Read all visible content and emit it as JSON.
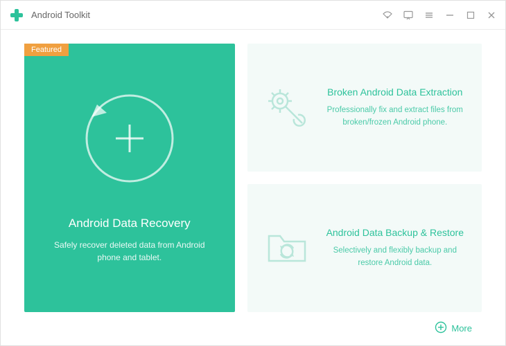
{
  "app": {
    "title": "Android Toolkit"
  },
  "featured_badge": "Featured",
  "cards": {
    "recovery": {
      "title": "Android Data Recovery",
      "desc": "Safely recover deleted data from Android phone and tablet."
    },
    "extraction": {
      "title": "Broken Android Data Extraction",
      "desc": "Professionally fix and extract files from broken/frozen Android phone."
    },
    "backup": {
      "title": "Android Data Backup & Restore",
      "desc": "Selectively and flexibly backup and restore Android data."
    }
  },
  "more_label": "More"
}
